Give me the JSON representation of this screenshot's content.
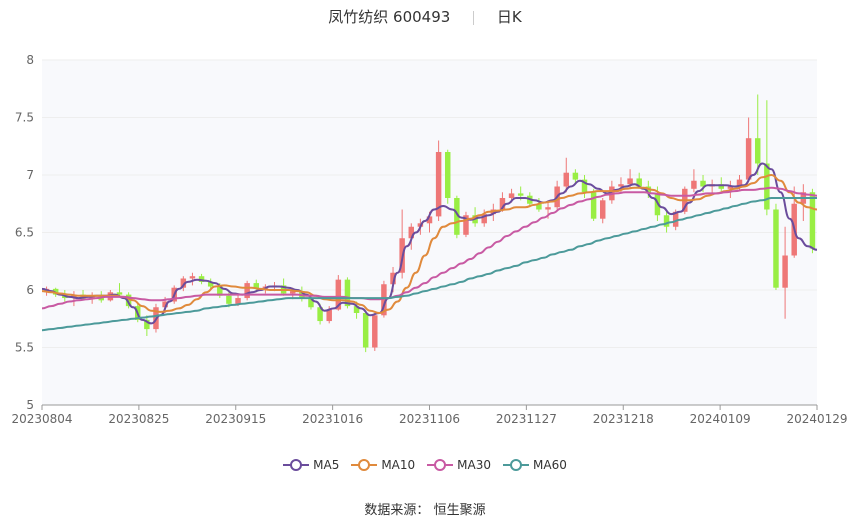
{
  "header": {
    "title": "凤竹纺织 600493",
    "period": "日K"
  },
  "source": {
    "label": "数据来源：",
    "name": "恒生聚源"
  },
  "colors": {
    "up": "#ee7777",
    "down": "#99ee44",
    "grid": "#eeeeee",
    "axis": "#666666",
    "plot_bg": "#f8f9fc"
  },
  "chart_data": {
    "type": "candlestick",
    "ylim": [
      5,
      8
    ],
    "y_ticks": [
      "5",
      "5.5",
      "6",
      "6.5",
      "7",
      "7.5",
      "8"
    ],
    "x_ticks": [
      "20230804",
      "20230825",
      "20230915",
      "20231016",
      "20231106",
      "20231127",
      "20231218",
      "20240109",
      "20240129"
    ],
    "candles": [
      {
        "o": 5.98,
        "h": 6.03,
        "l": 5.95,
        "c": 6.01
      },
      {
        "o": 6.01,
        "h": 6.02,
        "l": 5.94,
        "c": 5.96
      },
      {
        "o": 5.96,
        "h": 6.0,
        "l": 5.9,
        "c": 5.93
      },
      {
        "o": 5.93,
        "h": 5.99,
        "l": 5.86,
        "c": 5.96
      },
      {
        "o": 5.96,
        "h": 6.0,
        "l": 5.91,
        "c": 5.92
      },
      {
        "o": 5.92,
        "h": 5.98,
        "l": 5.88,
        "c": 5.95
      },
      {
        "o": 5.95,
        "h": 5.99,
        "l": 5.89,
        "c": 5.91
      },
      {
        "o": 5.91,
        "h": 6.0,
        "l": 5.9,
        "c": 5.98
      },
      {
        "o": 5.98,
        "h": 6.06,
        "l": 5.94,
        "c": 5.96
      },
      {
        "o": 5.96,
        "h": 5.98,
        "l": 5.84,
        "c": 5.86
      },
      {
        "o": 5.86,
        "h": 5.88,
        "l": 5.72,
        "c": 5.74
      },
      {
        "o": 5.74,
        "h": 5.78,
        "l": 5.6,
        "c": 5.66
      },
      {
        "o": 5.66,
        "h": 5.88,
        "l": 5.63,
        "c": 5.85
      },
      {
        "o": 5.85,
        "h": 5.94,
        "l": 5.8,
        "c": 5.9
      },
      {
        "o": 5.9,
        "h": 6.04,
        "l": 5.88,
        "c": 6.02
      },
      {
        "o": 6.02,
        "h": 6.12,
        "l": 5.99,
        "c": 6.1
      },
      {
        "o": 6.1,
        "h": 6.15,
        "l": 6.04,
        "c": 6.12
      },
      {
        "o": 6.12,
        "h": 6.14,
        "l": 6.05,
        "c": 6.07
      },
      {
        "o": 6.07,
        "h": 6.1,
        "l": 6.0,
        "c": 6.03
      },
      {
        "o": 6.03,
        "h": 6.06,
        "l": 5.93,
        "c": 5.95
      },
      {
        "o": 5.95,
        "h": 5.98,
        "l": 5.85,
        "c": 5.88
      },
      {
        "o": 5.88,
        "h": 5.97,
        "l": 5.86,
        "c": 5.93
      },
      {
        "o": 5.93,
        "h": 6.08,
        "l": 5.91,
        "c": 6.06
      },
      {
        "o": 6.06,
        "h": 6.09,
        "l": 5.98,
        "c": 6.01
      },
      {
        "o": 6.01,
        "h": 6.05,
        "l": 5.97,
        "c": 6.03
      },
      {
        "o": 6.03,
        "h": 6.07,
        "l": 5.99,
        "c": 6.04
      },
      {
        "o": 6.04,
        "h": 6.1,
        "l": 5.95,
        "c": 5.97
      },
      {
        "o": 5.97,
        "h": 6.02,
        "l": 5.92,
        "c": 5.99
      },
      {
        "o": 5.99,
        "h": 6.03,
        "l": 5.9,
        "c": 5.93
      },
      {
        "o": 5.93,
        "h": 5.96,
        "l": 5.83,
        "c": 5.85
      },
      {
        "o": 5.85,
        "h": 5.88,
        "l": 5.7,
        "c": 5.73
      },
      {
        "o": 5.73,
        "h": 5.86,
        "l": 5.71,
        "c": 5.83
      },
      {
        "o": 5.83,
        "h": 6.13,
        "l": 5.82,
        "c": 6.09
      },
      {
        "o": 6.09,
        "h": 6.11,
        "l": 5.84,
        "c": 5.86
      },
      {
        "o": 5.86,
        "h": 5.9,
        "l": 5.75,
        "c": 5.8
      },
      {
        "o": 5.8,
        "h": 5.82,
        "l": 5.46,
        "c": 5.5
      },
      {
        "o": 5.5,
        "h": 5.8,
        "l": 5.47,
        "c": 5.78
      },
      {
        "o": 5.78,
        "h": 6.08,
        "l": 5.76,
        "c": 6.05
      },
      {
        "o": 6.05,
        "h": 6.2,
        "l": 5.98,
        "c": 6.15
      },
      {
        "o": 6.15,
        "h": 6.7,
        "l": 6.1,
        "c": 6.45
      },
      {
        "o": 6.45,
        "h": 6.58,
        "l": 6.35,
        "c": 6.55
      },
      {
        "o": 6.55,
        "h": 6.62,
        "l": 6.48,
        "c": 6.58
      },
      {
        "o": 6.58,
        "h": 6.68,
        "l": 6.5,
        "c": 6.64
      },
      {
        "o": 6.64,
        "h": 7.3,
        "l": 6.6,
        "c": 7.2
      },
      {
        "o": 7.2,
        "h": 7.22,
        "l": 6.75,
        "c": 6.8
      },
      {
        "o": 6.8,
        "h": 6.82,
        "l": 6.45,
        "c": 6.48
      },
      {
        "o": 6.48,
        "h": 6.68,
        "l": 6.46,
        "c": 6.65
      },
      {
        "o": 6.65,
        "h": 6.72,
        "l": 6.55,
        "c": 6.58
      },
      {
        "o": 6.58,
        "h": 6.7,
        "l": 6.55,
        "c": 6.66
      },
      {
        "o": 6.66,
        "h": 6.75,
        "l": 6.6,
        "c": 6.7
      },
      {
        "o": 6.7,
        "h": 6.85,
        "l": 6.68,
        "c": 6.8
      },
      {
        "o": 6.8,
        "h": 6.88,
        "l": 6.76,
        "c": 6.84
      },
      {
        "o": 6.84,
        "h": 6.9,
        "l": 6.78,
        "c": 6.82
      },
      {
        "o": 6.82,
        "h": 6.85,
        "l": 6.72,
        "c": 6.75
      },
      {
        "o": 6.75,
        "h": 6.8,
        "l": 6.68,
        "c": 6.7
      },
      {
        "o": 6.7,
        "h": 6.78,
        "l": 6.62,
        "c": 6.72
      },
      {
        "o": 6.72,
        "h": 6.95,
        "l": 6.7,
        "c": 6.9
      },
      {
        "o": 6.9,
        "h": 7.15,
        "l": 6.85,
        "c": 7.02
      },
      {
        "o": 7.02,
        "h": 7.05,
        "l": 6.92,
        "c": 6.96
      },
      {
        "o": 6.96,
        "h": 7.0,
        "l": 6.8,
        "c": 6.85
      },
      {
        "o": 6.85,
        "h": 6.88,
        "l": 6.6,
        "c": 6.62
      },
      {
        "o": 6.62,
        "h": 6.8,
        "l": 6.58,
        "c": 6.78
      },
      {
        "o": 6.78,
        "h": 6.95,
        "l": 6.75,
        "c": 6.9
      },
      {
        "o": 6.9,
        "h": 6.98,
        "l": 6.85,
        "c": 6.92
      },
      {
        "o": 6.92,
        "h": 7.05,
        "l": 6.88,
        "c": 6.97
      },
      {
        "o": 6.97,
        "h": 7.02,
        "l": 6.88,
        "c": 6.9
      },
      {
        "o": 6.9,
        "h": 6.95,
        "l": 6.8,
        "c": 6.84
      },
      {
        "o": 6.84,
        "h": 6.9,
        "l": 6.6,
        "c": 6.65
      },
      {
        "o": 6.65,
        "h": 6.7,
        "l": 6.5,
        "c": 6.55
      },
      {
        "o": 6.55,
        "h": 6.7,
        "l": 6.52,
        "c": 6.68
      },
      {
        "o": 6.68,
        "h": 6.9,
        "l": 6.66,
        "c": 6.88
      },
      {
        "o": 6.88,
        "h": 7.05,
        "l": 6.85,
        "c": 6.95
      },
      {
        "o": 6.95,
        "h": 7.0,
        "l": 6.85,
        "c": 6.9
      },
      {
        "o": 6.9,
        "h": 6.96,
        "l": 6.84,
        "c": 6.92
      },
      {
        "o": 6.92,
        "h": 6.98,
        "l": 6.86,
        "c": 6.88
      },
      {
        "o": 6.88,
        "h": 6.95,
        "l": 6.8,
        "c": 6.9
      },
      {
        "o": 6.9,
        "h": 7.0,
        "l": 6.86,
        "c": 6.96
      },
      {
        "o": 6.96,
        "h": 7.5,
        "l": 6.94,
        "c": 7.32
      },
      {
        "o": 7.32,
        "h": 7.7,
        "l": 7.0,
        "c": 7.1
      },
      {
        "o": 7.1,
        "h": 7.65,
        "l": 6.65,
        "c": 6.7
      },
      {
        "o": 6.7,
        "h": 6.75,
        "l": 6.0,
        "c": 6.02
      },
      {
        "o": 6.02,
        "h": 6.55,
        "l": 5.75,
        "c": 6.3
      },
      {
        "o": 6.3,
        "h": 6.9,
        "l": 6.28,
        "c": 6.75
      },
      {
        "o": 6.75,
        "h": 6.92,
        "l": 6.6,
        "c": 6.85
      },
      {
        "o": 6.85,
        "h": 6.88,
        "l": 6.32,
        "c": 6.36
      }
    ],
    "series": [
      {
        "name": "MA5",
        "color": "#6a4c9c",
        "values": [
          6.01,
          5.99,
          5.96,
          5.94,
          5.93,
          5.94,
          5.95,
          5.95,
          5.96,
          5.93,
          5.85,
          5.74,
          5.71,
          5.78,
          5.9,
          6.01,
          6.07,
          6.09,
          6.08,
          6.06,
          6.01,
          5.97,
          5.96,
          5.98,
          6.0,
          6.03,
          6.03,
          6.02,
          6.0,
          5.96,
          5.9,
          5.82,
          5.84,
          5.89,
          5.88,
          5.84,
          5.78,
          5.8,
          5.93,
          6.15,
          6.38,
          6.5,
          6.6,
          6.7,
          6.73,
          6.7,
          6.63,
          6.61,
          6.63,
          6.65,
          6.68,
          6.75,
          6.8,
          6.8,
          6.78,
          6.76,
          6.78,
          6.84,
          6.9,
          6.95,
          6.92,
          6.88,
          6.84,
          6.87,
          6.9,
          6.92,
          6.88,
          6.8,
          6.72,
          6.66,
          6.68,
          6.76,
          6.86,
          6.91,
          6.91,
          6.91,
          6.9,
          6.91,
          7.0,
          7.1,
          7.05,
          6.85,
          6.62,
          6.45,
          6.38,
          6.35
        ]
      },
      {
        "name": "MA10",
        "color": "#e08a3c",
        "values": [
          5.99,
          5.98,
          5.97,
          5.96,
          5.95,
          5.95,
          5.95,
          5.95,
          5.95,
          5.94,
          5.91,
          5.86,
          5.82,
          5.81,
          5.82,
          5.84,
          5.87,
          5.92,
          5.98,
          6.03,
          6.04,
          6.03,
          6.02,
          6.02,
          6.01,
          6.0,
          6.0,
          6.0,
          5.99,
          5.98,
          5.95,
          5.92,
          5.91,
          5.91,
          5.9,
          5.87,
          5.82,
          5.8,
          5.83,
          5.9,
          6.02,
          6.15,
          6.3,
          6.45,
          6.55,
          6.58,
          6.6,
          6.62,
          6.65,
          6.68,
          6.69,
          6.7,
          6.72,
          6.72,
          6.74,
          6.76,
          6.77,
          6.8,
          6.82,
          6.84,
          6.85,
          6.86,
          6.86,
          6.86,
          6.88,
          6.89,
          6.89,
          6.87,
          6.84,
          6.8,
          6.78,
          6.78,
          6.79,
          6.82,
          6.84,
          6.86,
          6.88,
          6.9,
          6.93,
          6.98,
          7.0,
          6.95,
          6.85,
          6.76,
          6.72,
          6.7
        ]
      },
      {
        "name": "MA30",
        "color": "#c85aa3",
        "values": [
          5.84,
          5.86,
          5.88,
          5.9,
          5.91,
          5.92,
          5.93,
          5.94,
          5.94,
          5.94,
          5.93,
          5.92,
          5.91,
          5.91,
          5.92,
          5.93,
          5.94,
          5.95,
          5.96,
          5.96,
          5.96,
          5.96,
          5.96,
          5.96,
          5.96,
          5.96,
          5.96,
          5.96,
          5.96,
          5.95,
          5.95,
          5.94,
          5.94,
          5.94,
          5.93,
          5.93,
          5.92,
          5.92,
          5.93,
          5.95,
          5.98,
          6.02,
          6.06,
          6.11,
          6.15,
          6.19,
          6.23,
          6.27,
          6.32,
          6.37,
          6.42,
          6.47,
          6.51,
          6.55,
          6.59,
          6.63,
          6.67,
          6.71,
          6.74,
          6.77,
          6.79,
          6.81,
          6.83,
          6.84,
          6.85,
          6.85,
          6.85,
          6.84,
          6.83,
          6.82,
          6.82,
          6.82,
          6.83,
          6.84,
          6.84,
          6.85,
          6.86,
          6.87,
          6.87,
          6.88,
          6.89,
          6.88,
          6.86,
          6.84,
          6.83,
          6.82
        ]
      },
      {
        "name": "MA60",
        "color": "#4c9a9a",
        "values": [
          5.65,
          5.66,
          5.67,
          5.68,
          5.69,
          5.7,
          5.71,
          5.72,
          5.73,
          5.74,
          5.75,
          5.76,
          5.77,
          5.78,
          5.79,
          5.8,
          5.81,
          5.82,
          5.84,
          5.85,
          5.86,
          5.87,
          5.88,
          5.89,
          5.9,
          5.91,
          5.92,
          5.93,
          5.93,
          5.93,
          5.93,
          5.93,
          5.93,
          5.93,
          5.93,
          5.93,
          5.93,
          5.93,
          5.93,
          5.94,
          5.95,
          5.97,
          5.99,
          6.01,
          6.03,
          6.05,
          6.07,
          6.1,
          6.12,
          6.14,
          6.17,
          6.19,
          6.21,
          6.24,
          6.26,
          6.28,
          6.31,
          6.33,
          6.35,
          6.38,
          6.4,
          6.43,
          6.45,
          6.47,
          6.49,
          6.51,
          6.53,
          6.55,
          6.57,
          6.59,
          6.61,
          6.63,
          6.65,
          6.67,
          6.69,
          6.71,
          6.73,
          6.75,
          6.77,
          6.78,
          6.8,
          6.8,
          6.8,
          6.8,
          6.8,
          6.8
        ]
      }
    ],
    "legend": [
      "MA5",
      "MA10",
      "MA30",
      "MA60"
    ],
    "legend_position": "bottom"
  }
}
